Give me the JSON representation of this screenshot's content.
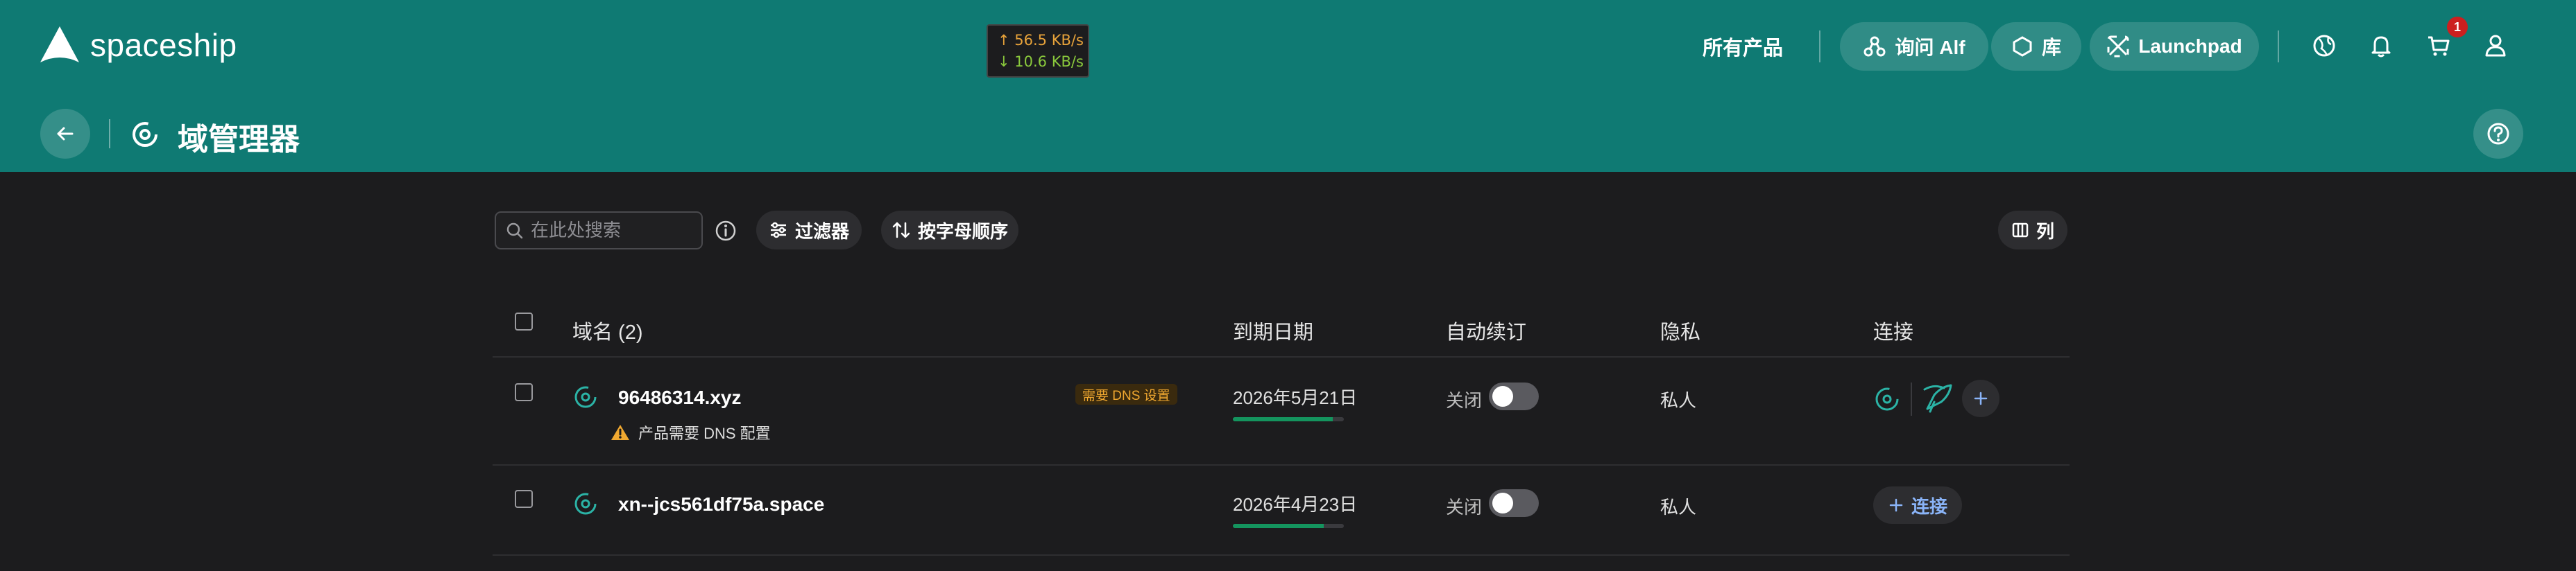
{
  "app": {
    "brand": "spaceship"
  },
  "speed_meter": {
    "up": "↑ 56.5 KB/s",
    "down": "↓ 10.6 KB/s"
  },
  "header": {
    "all_products": "所有产品",
    "ask_alf": "询问 Alf",
    "library": "库",
    "launchpad": "Launchpad",
    "cart_badge": "1",
    "icons": [
      "globe-icon",
      "bell-icon",
      "cart-icon",
      "user-icon"
    ]
  },
  "page": {
    "title": "域管理器"
  },
  "toolbar": {
    "search_placeholder": "在此处搜索",
    "filter_label": "过滤器",
    "sort_label": "按字母顺序",
    "columns_label": "列"
  },
  "table": {
    "headers": {
      "domain": "域名 (2)",
      "expiry": "到期日期",
      "auto_renew": "自动续订",
      "privacy": "隐私",
      "connection": "连接"
    },
    "rows": [
      {
        "domain": "96486314.xyz",
        "badge": "需要 DNS 设置",
        "warning": "产品需要 DNS 配置",
        "expiry": "2026年5月21日",
        "expiry_progress": 0.9,
        "auto_renew": "关闭",
        "auto_renew_on": false,
        "privacy": "私人",
        "connect_label": ""
      },
      {
        "domain": "xn--jcs561df75a.space",
        "badge": "",
        "warning": "",
        "expiry": "2026年4月23日",
        "expiry_progress": 0.82,
        "auto_renew": "关闭",
        "auto_renew_on": false,
        "privacy": "私人",
        "connect_label": "连接"
      }
    ]
  },
  "colors": {
    "header_bg": "#0f7a73",
    "body_bg": "#1c1c1e",
    "accent_green": "#14945e",
    "warning": "#f0a830",
    "link_blue": "#8ab4f8"
  }
}
